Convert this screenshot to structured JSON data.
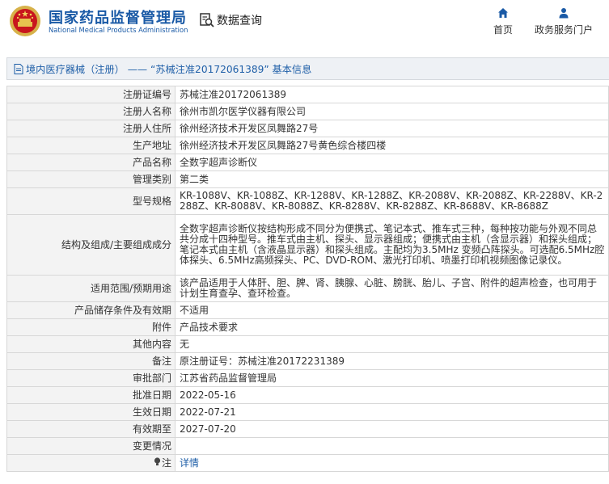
{
  "header": {
    "logo_cn": "国家药品监督管理局",
    "logo_en": "National Medical Products Administration",
    "search_label": "数据查询",
    "nav_home": "首页",
    "nav_gov": "政务服务门户"
  },
  "title": "境内医疗器械（注册） —— “苏械注准20172061389” 基本信息",
  "rows": [
    {
      "label": "注册证编号",
      "value": "苏械注准20172061389"
    },
    {
      "label": "注册人名称",
      "value": "徐州市凯尔医学仪器有限公司"
    },
    {
      "label": "注册人住所",
      "value": "徐州经济技术开发区凤舞路27号"
    },
    {
      "label": "生产地址",
      "value": "徐州经济技术开发区凤舞路27号黄色综合楼四楼"
    },
    {
      "label": "产品名称",
      "value": "全数字超声诊断仪"
    },
    {
      "label": "管理类别",
      "value": "第二类"
    },
    {
      "label": "型号规格",
      "value": "KR-1088V、KR-1088Z、KR-1288V、KR-1288Z、KR-2088V、KR-2088Z、KR-2288V、KR-2288Z、KR-8088V、KR-8088Z、KR-8288V、KR-8288Z、KR-8688V、KR-8688Z"
    },
    {
      "label": "结构及组成/主要组成成分",
      "value": "全数字超声诊断仪按结构形成不同分为便携式、笔记本式、推车式三种，每种按功能与外观不同总共分成十四种型号。推车式由主机、探头、显示器组成；便携式由主机（含显示器）和探头组成；笔记本式由主机（含液晶显示器）和探头组成。主配均为3.5MHz 变频凸阵探头。可选配6.5MHz腔体探头、6.5MHz高频探头、PC、DVD-ROM、激光打印机、喷墨打印机视频图像记录仪。"
    },
    {
      "label": "适用范围/预期用途",
      "value": "该产品适用于人体肝、胆、脾、肾、胰腺、心脏、膀胱、胎儿、子宫、附件的超声检查，也可用于计划生育查孕、查环检查。"
    },
    {
      "label": "产品储存条件及有效期",
      "value": "不适用"
    },
    {
      "label": "附件",
      "value": "产品技术要求"
    },
    {
      "label": "其他内容",
      "value": "无"
    },
    {
      "label": "备注",
      "value": "原注册证号：苏械注准20172231389"
    },
    {
      "label": "审批部门",
      "value": "江苏省药品监督管理局"
    },
    {
      "label": "批准日期",
      "value": "2022-05-16"
    },
    {
      "label": "生效日期",
      "value": "2022-07-21"
    },
    {
      "label": "有效期至",
      "value": "2027-07-20"
    },
    {
      "label": "变更情况",
      "value": ""
    },
    {
      "label": "注",
      "value": "详情"
    }
  ],
  "icons": {
    "emblem": "national-emblem-icon",
    "search": "search-document-icon",
    "home": "home-icon",
    "user": "user-icon",
    "doc": "document-icon",
    "bulb": "lightbulb-icon"
  },
  "colors": {
    "brand_blue": "#1a5aa6",
    "link_blue": "#1f5fa8",
    "label_bg": "#f3f3f3",
    "border": "#d7d7d7"
  }
}
